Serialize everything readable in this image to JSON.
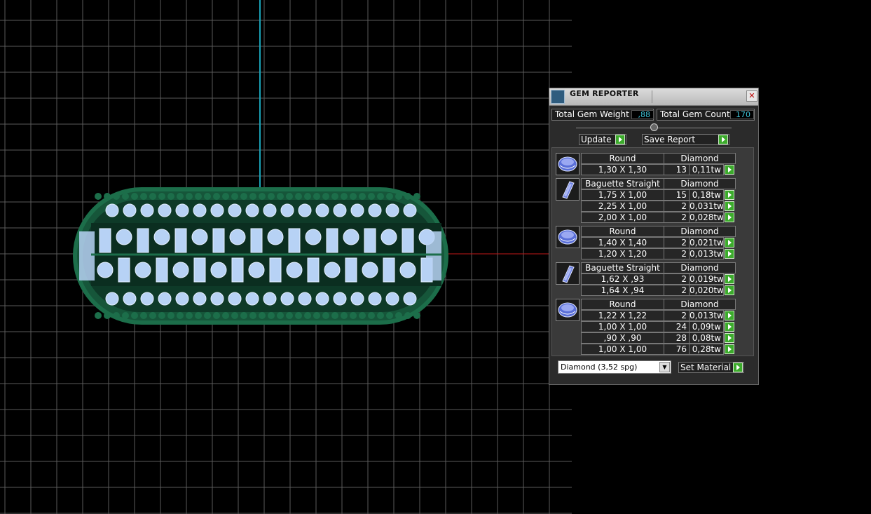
{
  "panel": {
    "title": "GEM REPORTER",
    "close_label": "✕",
    "total_weight_label": "Total Gem Weight",
    "total_weight_value": ",88",
    "total_count_label": "Total Gem Count",
    "total_count_value": "170",
    "update_label": "Update",
    "save_report_label": "Save Report",
    "material_select": "Diamond     (3,52 spg)",
    "set_material_label": "Set Material"
  },
  "groups": [
    {
      "icon": "round-gem-icon",
      "shape": "Round",
      "material": "Diamond",
      "rows": [
        {
          "size": "1,30 X 1,30",
          "count": "13",
          "weight": "0,11tw"
        }
      ]
    },
    {
      "icon": "baguette-gem-icon",
      "shape": "Baguette Straight",
      "material": "Diamond",
      "rows": [
        {
          "size": "1,75 X 1,00",
          "count": "15",
          "weight": "0,18tw"
        },
        {
          "size": "2,25 X 1,00",
          "count": "2",
          "weight": "0,031tw"
        },
        {
          "size": "2,00 X 1,00",
          "count": "2",
          "weight": "0,028tw"
        }
      ]
    },
    {
      "icon": "round-gem-icon",
      "shape": "Round",
      "material": "Diamond",
      "rows": [
        {
          "size": "1,40 X 1,40",
          "count": "2",
          "weight": "0,021tw"
        },
        {
          "size": "1,20 X 1,20",
          "count": "2",
          "weight": "0,013tw"
        }
      ]
    },
    {
      "icon": "baguette-gem-icon",
      "shape": "Baguette Straight",
      "material": "Diamond",
      "rows": [
        {
          "size": "1,62 X ,93",
          "count": "2",
          "weight": "0,019tw"
        },
        {
          "size": "1,64 X ,94",
          "count": "2",
          "weight": "0,020tw"
        }
      ]
    },
    {
      "icon": "round-gem-icon",
      "shape": "Round",
      "material": "Diamond",
      "rows": [
        {
          "size": "1,22 X 1,22",
          "count": "2",
          "weight": "0,013tw"
        },
        {
          "size": "1,00 X 1,00",
          "count": "24",
          "weight": "0,09tw"
        },
        {
          "size": ",90 X ,90",
          "count": "28",
          "weight": "0,08tw"
        },
        {
          "size": "1,00 X 1,00",
          "count": "76",
          "weight": "0,28tw"
        }
      ]
    }
  ],
  "colors": {
    "model_green": "#1c6e4a",
    "gem_blue": "#b7d2f5",
    "axis_red": "#c01818",
    "axis_cyan": "#1aa3b8",
    "grid": "#5a5a5a",
    "accent_green": "#3cab2c"
  }
}
